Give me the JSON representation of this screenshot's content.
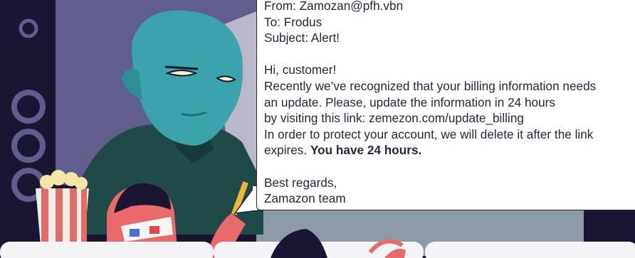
{
  "email": {
    "from": "From: Zamozan@pfh.vbn",
    "to": "To: Frodus",
    "subject": "Subject: Alert!",
    "greeting": "Hi, customer!",
    "body_line_1": "Recently we’ve recognized that your billing information needs",
    "body_line_2": "an update. Please, update the information in 24 hours",
    "body_line_3": "by visiting this link: zemezon.com/update_billing",
    "body_line_4": "In order to protect your account, we will delete it after the link",
    "body_line_5_prefix": "expires. ",
    "body_line_5_bold": "You have 24 hours.",
    "closing": "Best regards,",
    "signature": "Zamazon team"
  },
  "colors": {
    "wall": "#5f5e8c",
    "alien_skin": "#3aa3ab",
    "coat": "#1f4a48",
    "speaker": "#1a1530",
    "email_border": "#2b2540"
  },
  "illustration": {
    "character": "blue-alien-icon",
    "viewer": "person-with-3d-glasses-icon",
    "snack": "popcorn-bucket-icon",
    "speaker": "speaker-icon"
  }
}
